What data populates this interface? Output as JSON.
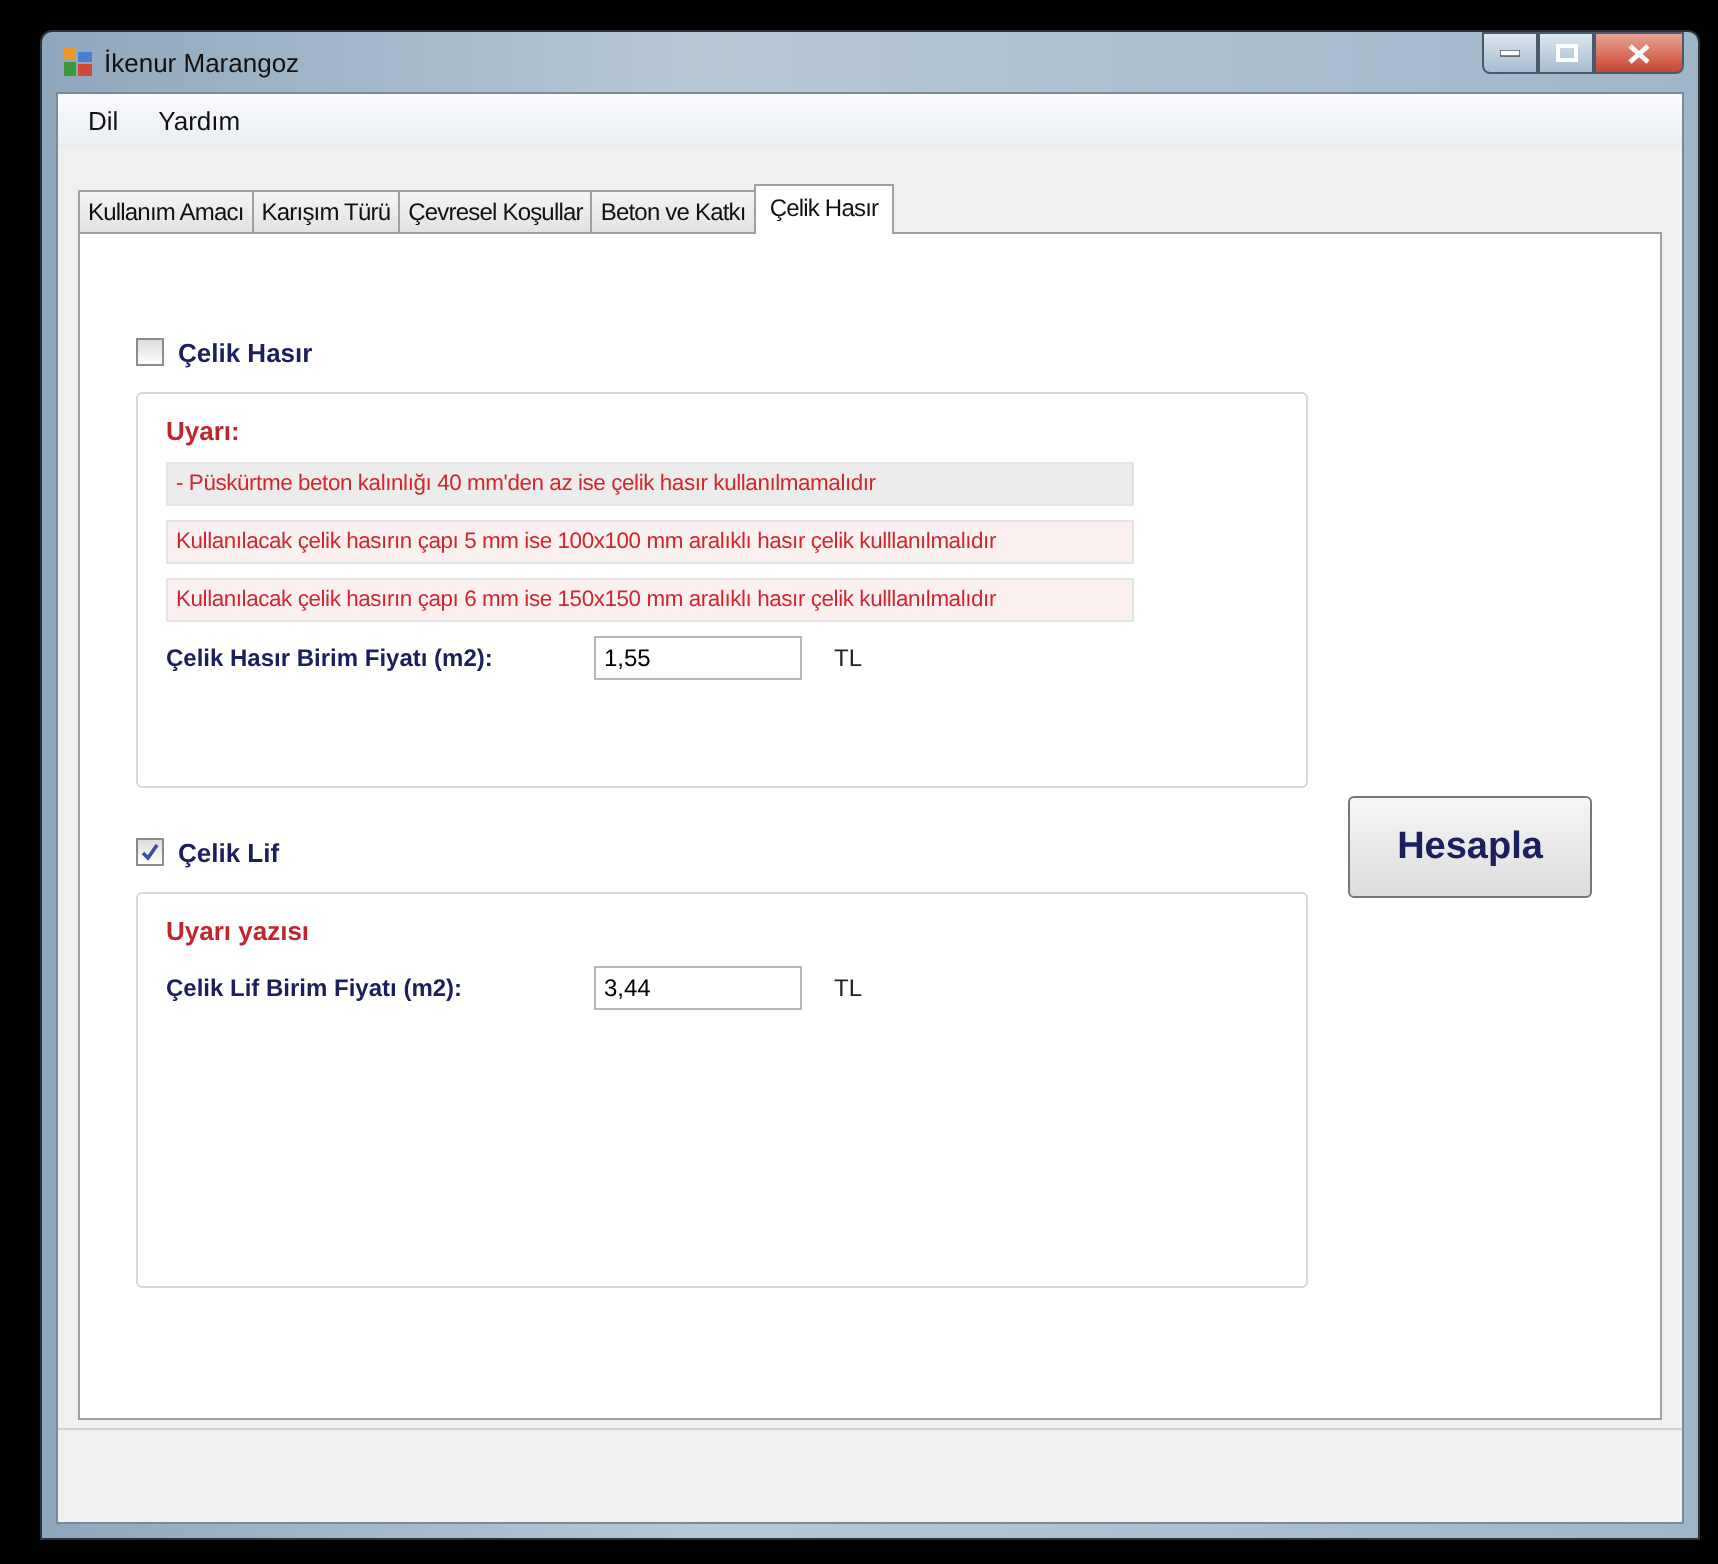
{
  "window": {
    "title": "İkenur Marangoz"
  },
  "menu": [
    "Dil",
    "Yardım"
  ],
  "tabs": [
    {
      "label": "Kullanım Amacı",
      "selected": false
    },
    {
      "label": "Karışım Türü",
      "selected": false
    },
    {
      "label": "Çevresel Koşullar",
      "selected": false
    },
    {
      "label": "Beton ve Katkı",
      "selected": false
    },
    {
      "label": "Çelik Hasır",
      "selected": true
    }
  ],
  "sections": [
    {
      "label": "Çelik Hasır",
      "checked": false,
      "warning_title": "Uyarı:",
      "warnings": [
        {
          "kind": "note",
          "text": "-  Püskürtme beton kalınlığı 40 mm'den az ise çelik hasır kullanılmamalıdır"
        },
        {
          "kind": "rule",
          "text": "Kullanılacak çelik hasırın çapı 5 mm ise 100x100 mm aralıklı hasır çelik kulllanılmalıdır"
        },
        {
          "kind": "rule",
          "text": "Kullanılacak çelik hasırın çapı 6 mm ise 150x150 mm aralıklı hasır çelik kulllanılmalıdır"
        }
      ],
      "price_label": "Çelik Hasır Birim Fiyatı (m2):",
      "price_value": "1,55",
      "unit": "TL"
    },
    {
      "label": "Çelik Lif",
      "checked": true,
      "warning_title": "Uyarı yazısı",
      "price_label": "Çelik Lif Birim Fiyatı (m2):",
      "price_value": "3,44",
      "unit": "TL"
    }
  ],
  "button": "Hesapla"
}
